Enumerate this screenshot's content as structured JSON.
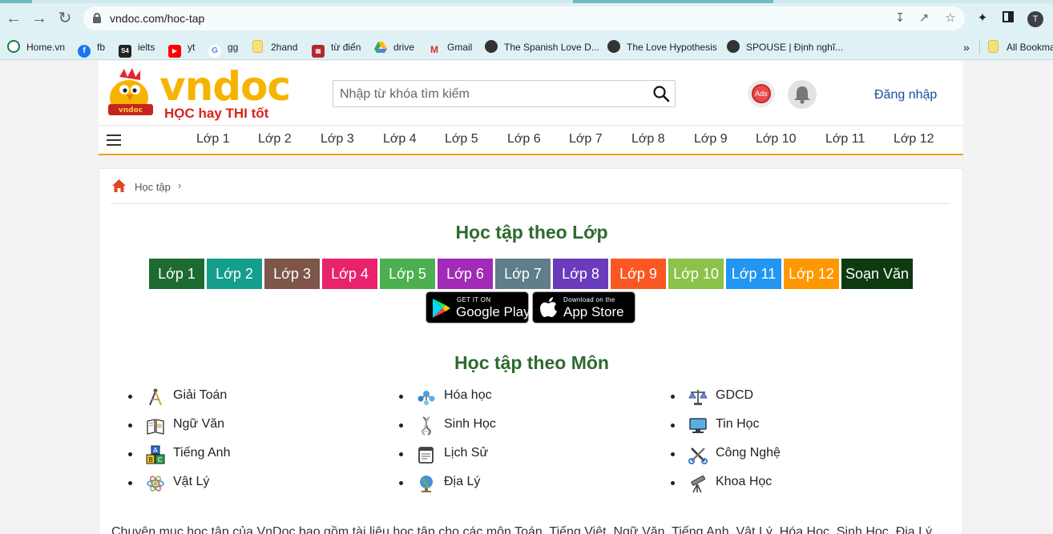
{
  "browser": {
    "url": "vndoc.com/hoc-tap",
    "profile_initial": "T",
    "bookmarks": [
      {
        "label": "Home.vn",
        "icon": "homevn-icon"
      },
      {
        "label": "fb",
        "icon": "facebook-icon"
      },
      {
        "label": "ielts",
        "icon": "ielts-icon",
        "icon_text": "S4"
      },
      {
        "label": "yt",
        "icon": "youtube-icon"
      },
      {
        "label": "gg",
        "icon": "google-icon",
        "icon_text": "G"
      },
      {
        "label": "2hand",
        "icon": "folder-icon"
      },
      {
        "label": "từ điển",
        "icon": "cambridge-icon"
      },
      {
        "label": "drive",
        "icon": "drive-icon"
      },
      {
        "label": "Gmail",
        "icon": "gmail-icon",
        "icon_text": "M"
      },
      {
        "label": "The Spanish Love D...",
        "icon": "globe-icon"
      },
      {
        "label": "The Love Hypothesis",
        "icon": "globe-icon"
      },
      {
        "label": "SPOUSE | Định nghĩ...",
        "icon": "globe-icon"
      }
    ],
    "overflow_label": "»",
    "all_bookmarks": "All Bookma"
  },
  "header": {
    "logo_wordmark": "vndoc",
    "logo_slogan": "HỌC hay THI tốt",
    "search_placeholder": "Nhập từ khóa tìm kiếm",
    "ads_badge": "Ads",
    "login": "Đăng nhập"
  },
  "menu": [
    "Lớp 1",
    "Lớp 2",
    "Lớp 3",
    "Lớp 4",
    "Lớp 5",
    "Lớp 6",
    "Lớp 7",
    "Lớp 8",
    "Lớp 9",
    "Lớp 10",
    "Lớp 11",
    "Lớp 12"
  ],
  "breadcrumb": {
    "label": "Học tập",
    "sep": "›"
  },
  "grades_section": {
    "title": "Học tập theo Lớp",
    "buttons": [
      {
        "label": "Lớp 1",
        "color": "#1e6b32"
      },
      {
        "label": "Lớp 2",
        "color": "#149e8c"
      },
      {
        "label": "Lớp 3",
        "color": "#7d5549"
      },
      {
        "label": "Lớp 4",
        "color": "#e9226d"
      },
      {
        "label": "Lớp 5",
        "color": "#4caf50"
      },
      {
        "label": "Lớp 6",
        "color": "#a12ab6"
      },
      {
        "label": "Lớp 7",
        "color": "#5f7d8a"
      },
      {
        "label": "Lớp 8",
        "color": "#6a3bba"
      },
      {
        "label": "Lớp 9",
        "color": "#fb5722"
      },
      {
        "label": "Lớp 10",
        "color": "#8bc34a"
      },
      {
        "label": "Lớp 11",
        "color": "#2196f3"
      },
      {
        "label": "Lớp 12",
        "color": "#ff9800"
      },
      {
        "label": "Soạn Văn",
        "color": "#0e3a10"
      }
    ],
    "google_play": {
      "small": "GET IT ON",
      "big": "Google Play"
    },
    "app_store": {
      "small": "Download on the",
      "big": "App Store"
    }
  },
  "subjects_section": {
    "title": "Học tập theo Môn",
    "columns": [
      [
        {
          "label": "Giải Toán",
          "icon": "compass-icon"
        },
        {
          "label": "Ngữ Văn",
          "icon": "book-icon"
        },
        {
          "label": "Tiếng Anh",
          "icon": "abc-blocks-icon"
        },
        {
          "label": "Vật Lý",
          "icon": "atom-icon"
        }
      ],
      [
        {
          "label": "Hóa học",
          "icon": "molecule-icon"
        },
        {
          "label": "Sinh Học",
          "icon": "dna-icon"
        },
        {
          "label": "Lịch Sử",
          "icon": "scroll-icon"
        },
        {
          "label": "Địa Lý",
          "icon": "globe-icon"
        }
      ],
      [
        {
          "label": "GDCD",
          "icon": "scales-icon"
        },
        {
          "label": "Tin Học",
          "icon": "computer-icon"
        },
        {
          "label": "Công Nghệ",
          "icon": "tools-icon"
        },
        {
          "label": "Khoa Học",
          "icon": "telescope-icon"
        }
      ]
    ]
  },
  "description": "Chuyên mục học tập của VnDoc bao gồm tài liệu học tập cho các môn Toán, Tiếng Việt, Ngữ Văn, Tiếng Anh, Vật Lý, Hóa Học, Sinh Học, Địa Lý"
}
